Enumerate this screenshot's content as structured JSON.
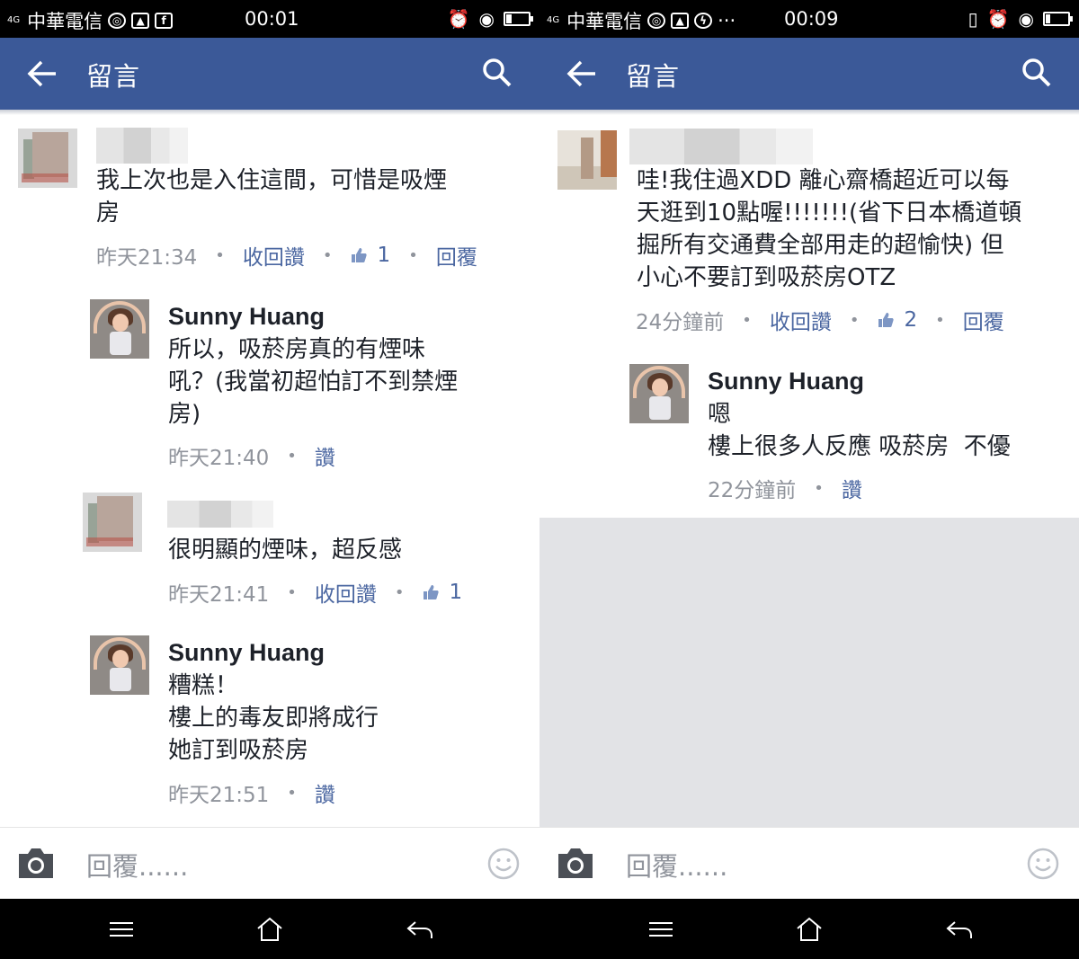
{
  "left": {
    "status": {
      "carrier": "中華電信",
      "time": "00:01",
      "network": "4G"
    },
    "appbar": {
      "title": "留言"
    },
    "comments": [
      {
        "text": "我上次也是入住這間，可惜是吸煙\n房",
        "time": "昨天21:34",
        "unlike": "收回讚",
        "likes": "1",
        "reply": "回覆"
      },
      {
        "name": "Sunny Huang",
        "text": "所以，吸菸房真的有煙味\n吼？(我當初超怕訂不到禁煙\n房)",
        "time": "昨天21:40",
        "like": "讚"
      },
      {
        "text": "很明顯的煙味，超反感",
        "time": "昨天21:41",
        "unlike": "收回讚",
        "likes": "1"
      },
      {
        "name": "Sunny Huang",
        "text": "糟糕！\n樓上的毒友即將成行\n她訂到吸菸房",
        "time": "昨天21:51",
        "like": "讚"
      }
    ],
    "reply_placeholder": "回覆......"
  },
  "right": {
    "status": {
      "carrier": "中華電信",
      "time": "00:09",
      "network": "4G"
    },
    "appbar": {
      "title": "留言"
    },
    "comments": [
      {
        "text": "哇!我住過XDD 離心齋橋超近可以每\n天逛到10點喔!!!!!!!(省下日本橋道頓\n掘所有交通費全部用走的超愉快) 但\n小心不要訂到吸菸房OTZ",
        "time": "24分鐘前",
        "unlike": "收回讚",
        "likes": "2",
        "reply": "回覆"
      },
      {
        "name": "Sunny Huang",
        "text": "嗯\n樓上很多人反應 吸菸房  不優",
        "time": "22分鐘前",
        "like": "讚"
      }
    ],
    "reply_placeholder": "回覆......"
  },
  "colors": {
    "appbar": "#3b5998",
    "link": "#4b67a1",
    "meta": "#90949c",
    "text": "#1d2129"
  },
  "icons": [
    "back-arrow-icon",
    "search-icon",
    "thumbs-up-icon",
    "camera-icon",
    "smiley-icon",
    "menu-icon",
    "home-icon",
    "back-nav-icon",
    "alarm-icon",
    "eye-icon",
    "battery-icon",
    "facebook-icon",
    "messenger-icon",
    "image-icon"
  ]
}
